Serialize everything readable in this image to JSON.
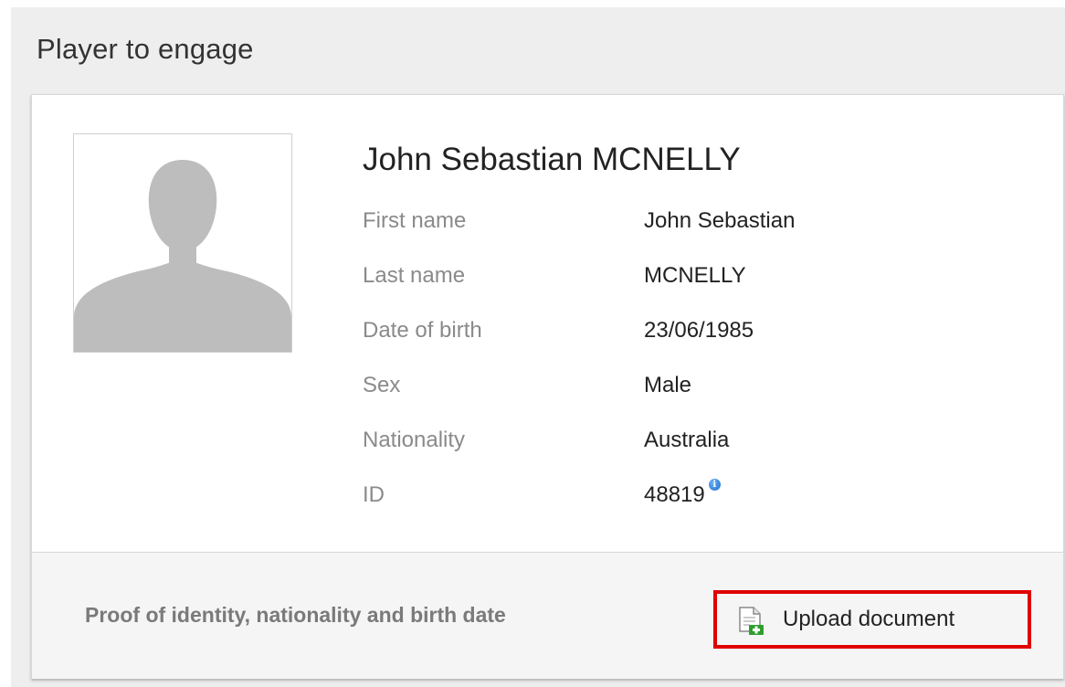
{
  "panel": {
    "title": "Player to engage"
  },
  "player": {
    "full_name": "John Sebastian MCNELLY",
    "photo_icon": "avatar-placeholder",
    "fields": [
      {
        "label": "First name",
        "value": "John Sebastian"
      },
      {
        "label": "Last name",
        "value": "MCNELLY"
      },
      {
        "label": "Date of birth",
        "value": "23/06/1985"
      },
      {
        "label": "Sex",
        "value": "Male"
      },
      {
        "label": "Nationality",
        "value": "Australia"
      },
      {
        "label": "ID",
        "value": "48819"
      }
    ],
    "id_info_icon": "info-icon"
  },
  "proof": {
    "label": "Proof of identity, nationality and birth date",
    "upload_button_label": "Upload document",
    "upload_icon": "document-add-icon"
  },
  "colors": {
    "highlight_border": "#e00000",
    "info_icon": "#1f6fd0",
    "add_plus": "#2e9e2e"
  }
}
